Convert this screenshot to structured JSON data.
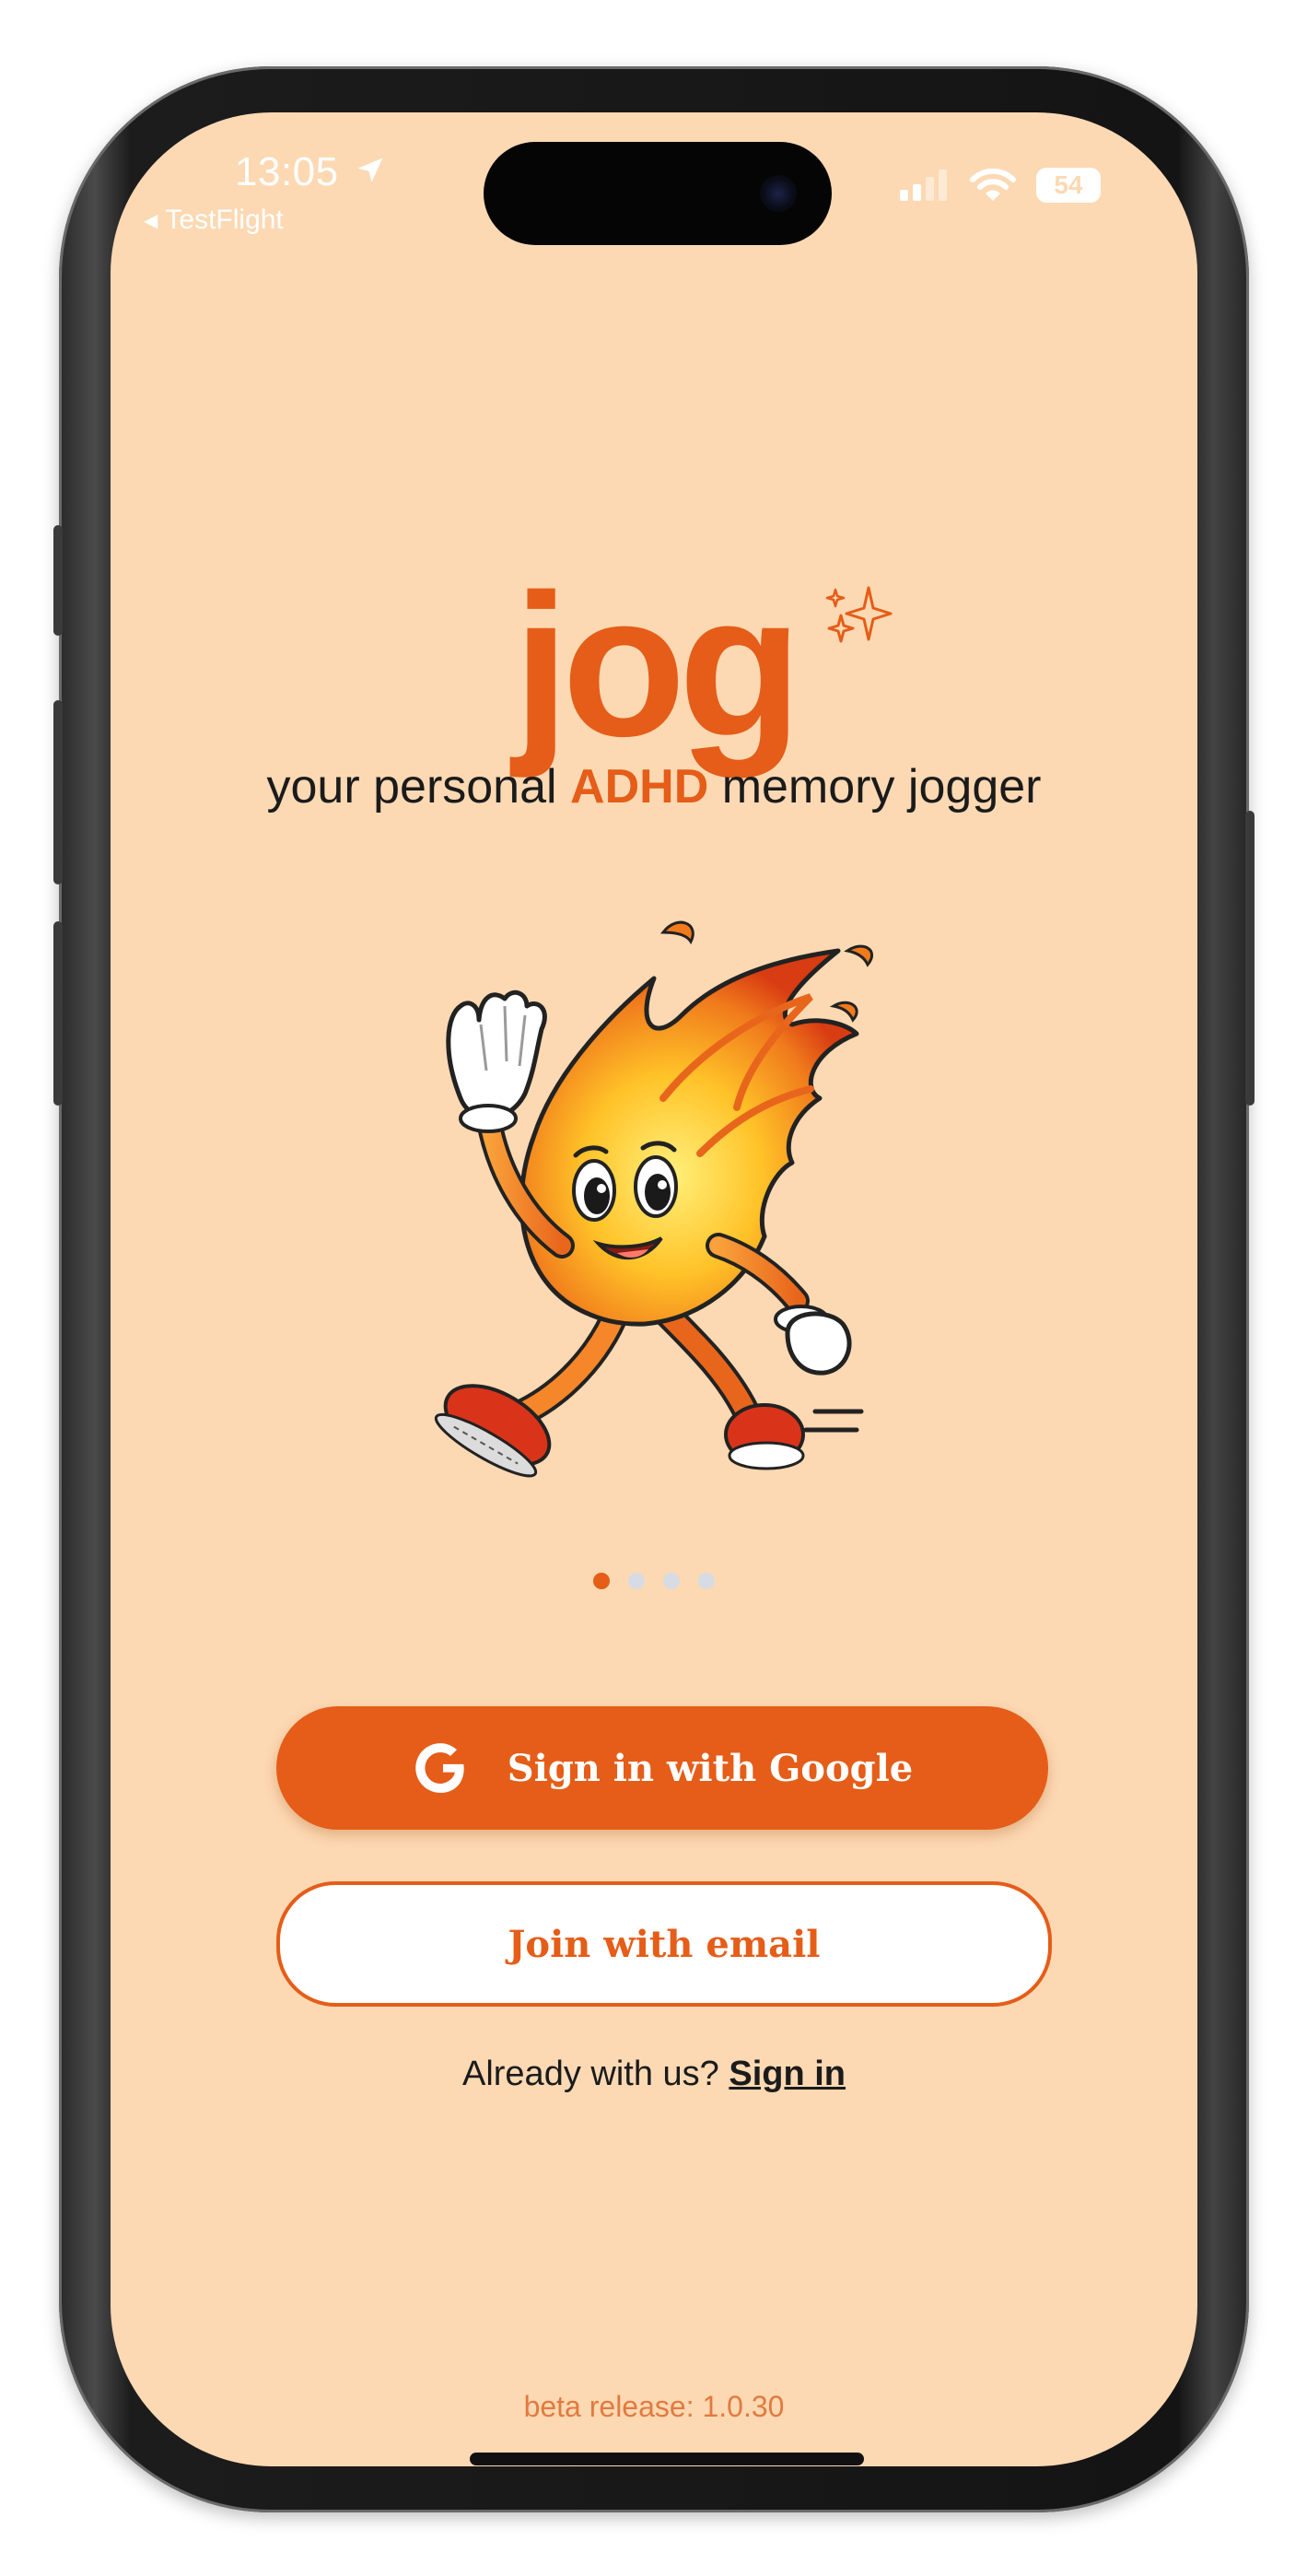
{
  "status_bar": {
    "time": "13:05",
    "back_app": "TestFlight",
    "battery": "54"
  },
  "brand": {
    "logo_text": "jog",
    "tagline_before": "your personal ",
    "tagline_highlight": "ADHD",
    "tagline_after": " memory jogger"
  },
  "mascot": {
    "icon": "flame-mascot-illustration"
  },
  "carousel": {
    "page_count": 4,
    "active_index": 0
  },
  "actions": {
    "google_label": "Sign in with Google",
    "email_label": "Join with email",
    "already_text": "Already with us? ",
    "signin_link": "Sign in"
  },
  "footer": {
    "version": "beta release: 1.0.30"
  },
  "colors": {
    "background": "#fcd9b3",
    "accent": "#e55d18",
    "dot_inactive": "#d7dbe3"
  }
}
